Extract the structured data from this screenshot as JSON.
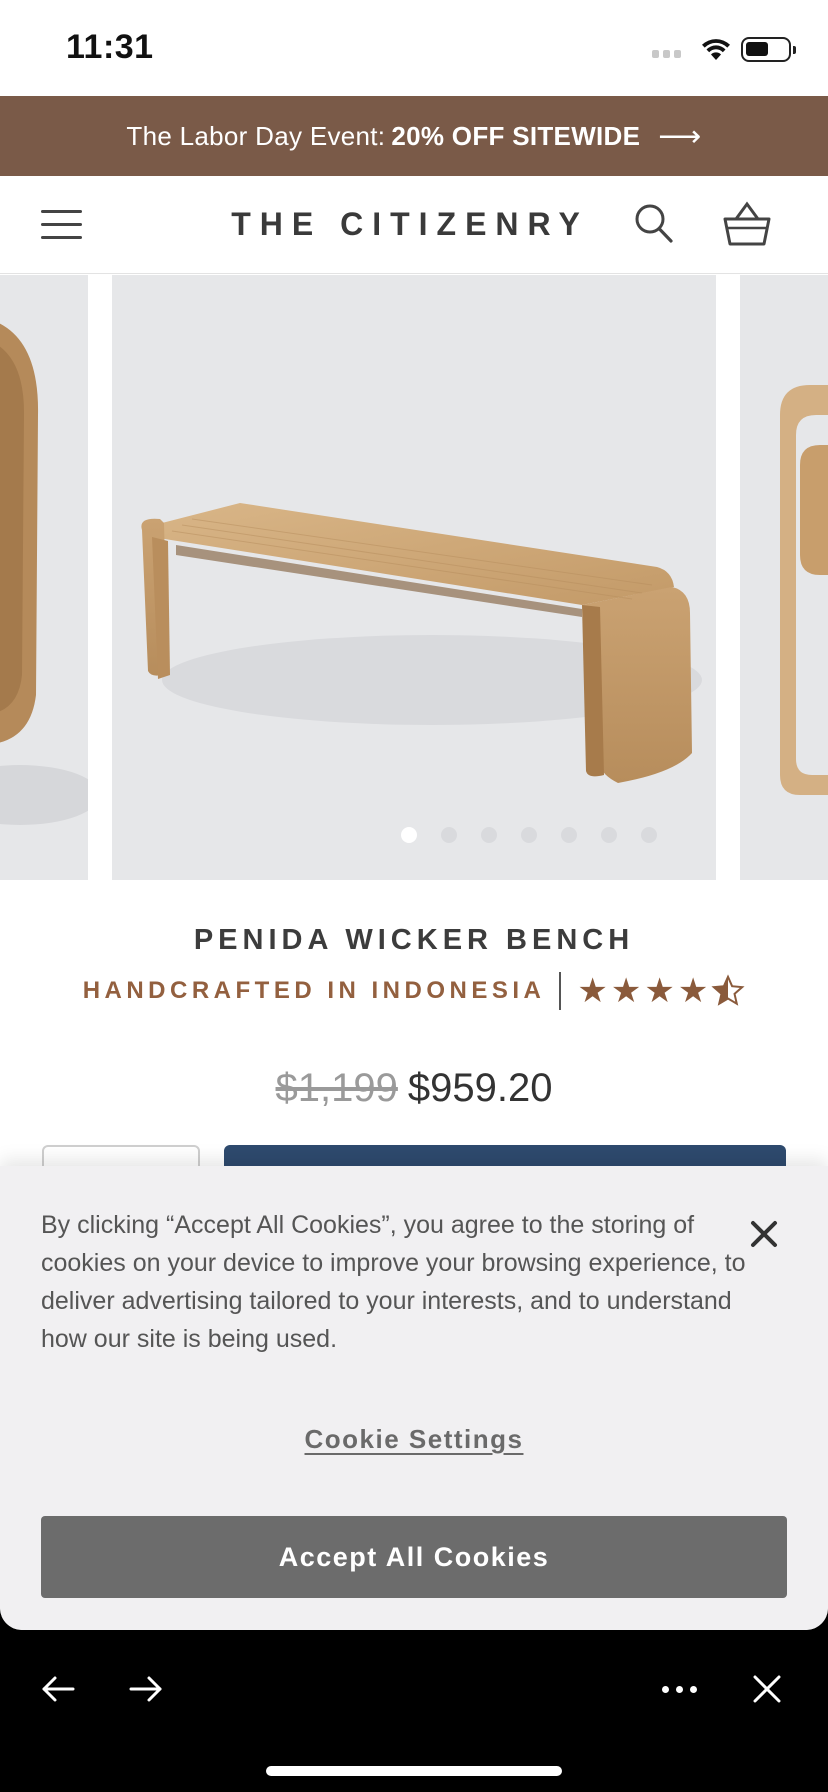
{
  "status_bar": {
    "time": "11:31"
  },
  "promo": {
    "text": "The Labor Day Event:",
    "bold": "20% OFF SITEWIDE",
    "arrow": "⟶"
  },
  "header": {
    "logo": "THE CITIZENRY"
  },
  "gallery": {
    "slide_count": 7,
    "active_index": 0
  },
  "product": {
    "title": "PENIDA WICKER BENCH",
    "subtitle": "HANDCRAFTED IN INDONESIA",
    "rating": 4.5,
    "rating_max": 5,
    "old_price": "$1,199",
    "price": "$959.20"
  },
  "cookie_banner": {
    "text": "By clicking “Accept All Cookies”, you agree to the storing of cookies on your device to improve your browsing experience, to deliver advertising tailored to your interests, and to understand how our site is being used.",
    "settings_label": "Cookie Settings",
    "accept_label": "Accept All Cookies"
  },
  "colors": {
    "promo_bg": "#7a5a48",
    "brand_brown": "#93603f",
    "add_to_cart_bg": "#2e4a6e",
    "accept_bg": "#6c6c6c"
  }
}
